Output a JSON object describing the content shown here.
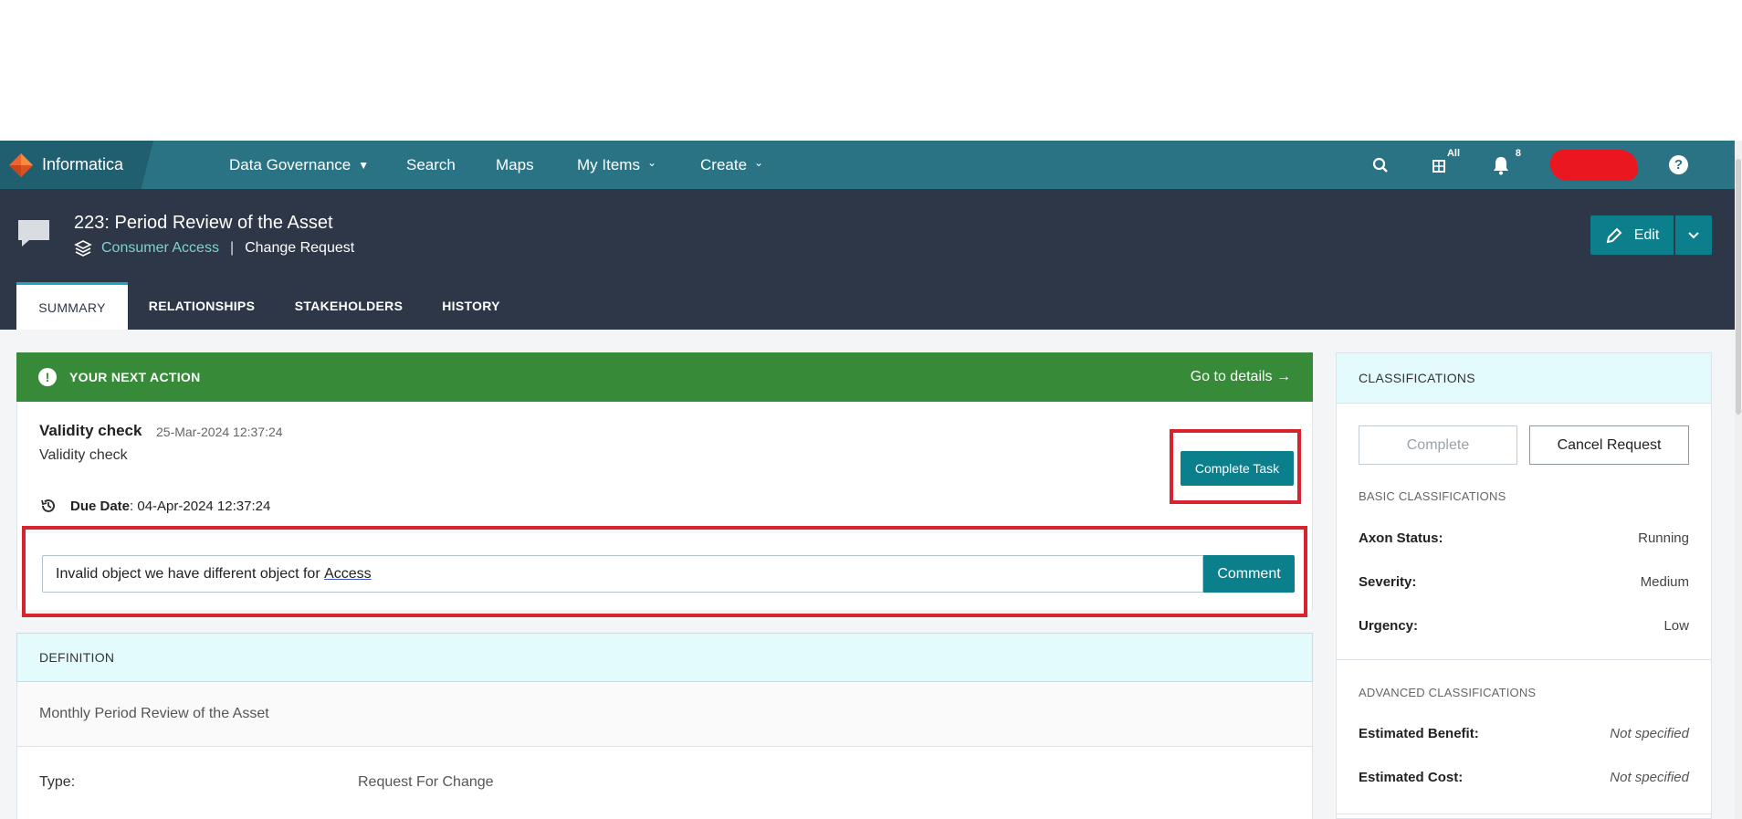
{
  "nav": {
    "brand": "Informatica",
    "items": [
      {
        "label": "Data Governance",
        "caret": "▼"
      },
      {
        "label": "Search"
      },
      {
        "label": "Maps"
      },
      {
        "label": "My Items",
        "caret": "⌄"
      },
      {
        "label": "Create",
        "caret": "⌄"
      }
    ],
    "filter_badge": "All",
    "notification_count": "8",
    "help": "?",
    "colors": {
      "bar": "#2a7385",
      "brand_bg": "#1f5f6f"
    }
  },
  "header": {
    "title": "223: Period Review of the Asset",
    "breadcrumb_link": "Consumer Access",
    "separator": "|",
    "object_type": "Change Request",
    "edit_label": "Edit",
    "tabs": [
      "SUMMARY",
      "RELATIONSHIPS",
      "STAKEHOLDERS",
      "HISTORY"
    ],
    "active_tab": "SUMMARY",
    "colors": {
      "band": "#2e3747",
      "accent": "#0c7f8c",
      "link": "#7fd1cf"
    }
  },
  "next_action": {
    "heading": "YOUR NEXT ACTION",
    "goto": "Go to details →",
    "task_title": "Validity check",
    "task_timestamp": "25-Mar-2024 12:37:24",
    "task_description": "Validity check",
    "due_label": "Due Date",
    "due_value": ": 04-Apr-2024 12:37:24",
    "complete_task_label": "Complete Task",
    "comment_text_prefix": "Invalid object we have different object for ",
    "comment_text_underlined": "Access",
    "comment_button": "Comment",
    "colors": {
      "bar": "#378a38",
      "highlight": "#d6232e"
    }
  },
  "definition": {
    "heading": "DEFINITION",
    "text": "Monthly Period Review of the Asset",
    "type_label": "Type:",
    "type_value": "Request For Change"
  },
  "classifications": {
    "heading": "CLASSIFICATIONS",
    "complete_label": "Complete",
    "cancel_label": "Cancel Request",
    "basic_heading": "BASIC CLASSIFICATIONS",
    "basic": [
      {
        "key": "Axon Status:",
        "value": "Running"
      },
      {
        "key": "Severity:",
        "value": "Medium"
      },
      {
        "key": "Urgency:",
        "value": "Low"
      }
    ],
    "advanced_heading": "ADVANCED CLASSIFICATIONS",
    "advanced": [
      {
        "key": "Estimated Benefit:",
        "value": "Not specified"
      },
      {
        "key": "Estimated Cost:",
        "value": "Not specified"
      }
    ]
  }
}
